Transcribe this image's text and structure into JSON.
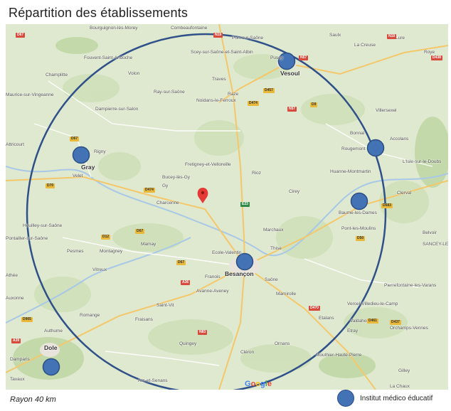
{
  "title": "Répartition des  établissements",
  "map": {
    "places": [
      {
        "name": "Bourguignon-lès-Morey"
      },
      {
        "name": "Combeaufontaine"
      },
      {
        "name": "Port-sur-Saône"
      },
      {
        "name": "Saulx"
      },
      {
        "name": "Lure"
      },
      {
        "name": "La Creuse"
      },
      {
        "name": "Fouvent-Saint-Andoche"
      },
      {
        "name": "Scey-sur-Saône-et-Saint-Albin"
      },
      {
        "name": "Pusey"
      },
      {
        "name": "Vesoul"
      },
      {
        "name": "Champlitte"
      },
      {
        "name": "Volon"
      },
      {
        "name": "Traves"
      },
      {
        "name": "Maurice-sur-Vingeanne"
      },
      {
        "name": "Ray-sur-Saône"
      },
      {
        "name": "Raze"
      },
      {
        "name": "Noidans-le-Ferroux"
      },
      {
        "name": "Dampierre-sur-Salon"
      },
      {
        "name": "Villersexel"
      },
      {
        "name": "Bonnal"
      },
      {
        "name": "Accolans"
      },
      {
        "name": "Attricourt"
      },
      {
        "name": "Rigny"
      },
      {
        "name": "Fretigney-et-Velloreille"
      },
      {
        "name": "Rougemont"
      },
      {
        "name": "Gray"
      },
      {
        "name": "Velet"
      },
      {
        "name": "Bucey-lès-Gy"
      },
      {
        "name": "Rioz"
      },
      {
        "name": "Huanne-Montmartin"
      },
      {
        "name": "L'Isle-sur-le-Doubs"
      },
      {
        "name": "Gy"
      },
      {
        "name": "Cirey"
      },
      {
        "name": "Clerval"
      },
      {
        "name": "Charcenne"
      },
      {
        "name": "Baume-les-Dames"
      },
      {
        "name": "Heuilley-sur-Saône"
      },
      {
        "name": "Marchaux"
      },
      {
        "name": "Pont-les-Moulins"
      },
      {
        "name": "Pontailler-sur-Saône"
      },
      {
        "name": "Pesmes"
      },
      {
        "name": "Montagney"
      },
      {
        "name": "Mamay"
      },
      {
        "name": "Ecole-Valentin"
      },
      {
        "name": "Thise"
      },
      {
        "name": "Besançon"
      },
      {
        "name": "Vitreux"
      },
      {
        "name": "Franois"
      },
      {
        "name": "Saône"
      },
      {
        "name": "Avanne-Aveney"
      },
      {
        "name": "Mamirolle"
      },
      {
        "name": "Auxonne"
      },
      {
        "name": "Pierrefontaine-les-Varans"
      },
      {
        "name": "Saint-Vit"
      },
      {
        "name": "Romange"
      },
      {
        "name": "Vercel-Villedieu-le-Camp"
      },
      {
        "name": "Fraisans"
      },
      {
        "name": "Etalans"
      },
      {
        "name": "Valdahon"
      },
      {
        "name": "Orchamps-Vennes"
      },
      {
        "name": "Authume"
      },
      {
        "name": "Etray"
      },
      {
        "name": "Quingey"
      },
      {
        "name": "Ornans"
      },
      {
        "name": "Dole"
      },
      {
        "name": "Damparis"
      },
      {
        "name": "Cléron"
      },
      {
        "name": "Tavaux"
      },
      {
        "name": "Mouthier-Haute-Pierre"
      },
      {
        "name": "Gilley"
      },
      {
        "name": "Arc-et-Senans"
      },
      {
        "name": "La Chaux"
      },
      {
        "name": "Roye"
      },
      {
        "name": "Belvoir"
      },
      {
        "name": "SANCEY-LE-GRAND"
      },
      {
        "name": "Athée"
      }
    ],
    "roads": [
      "D67",
      "N19",
      "N57",
      "D457",
      "D474",
      "D9",
      "N57",
      "D67",
      "D70",
      "D474",
      "E23",
      "D683",
      "D12",
      "D67",
      "A36",
      "N83",
      "D50",
      "D461",
      "D437",
      "D905",
      "A39",
      "D67",
      "D438",
      "N19",
      "D470"
    ],
    "google_logo": "Google"
  },
  "institutes": [
    {
      "name": "Vesoul"
    },
    {
      "name": "Gray"
    },
    {
      "name": "Rougemont"
    },
    {
      "name": "Baume-les-Dames"
    },
    {
      "name": "Besançon"
    },
    {
      "name": "Dole"
    }
  ],
  "radius_caption": "Rayon  40 km",
  "legend": {
    "label": "Institut médico éducatif",
    "marker_color": "#4473b5"
  },
  "colors": {
    "circle": "#2f5089",
    "marker": "#4473b5",
    "pin": "#e53935",
    "map_bg": "#dfe9cf"
  }
}
